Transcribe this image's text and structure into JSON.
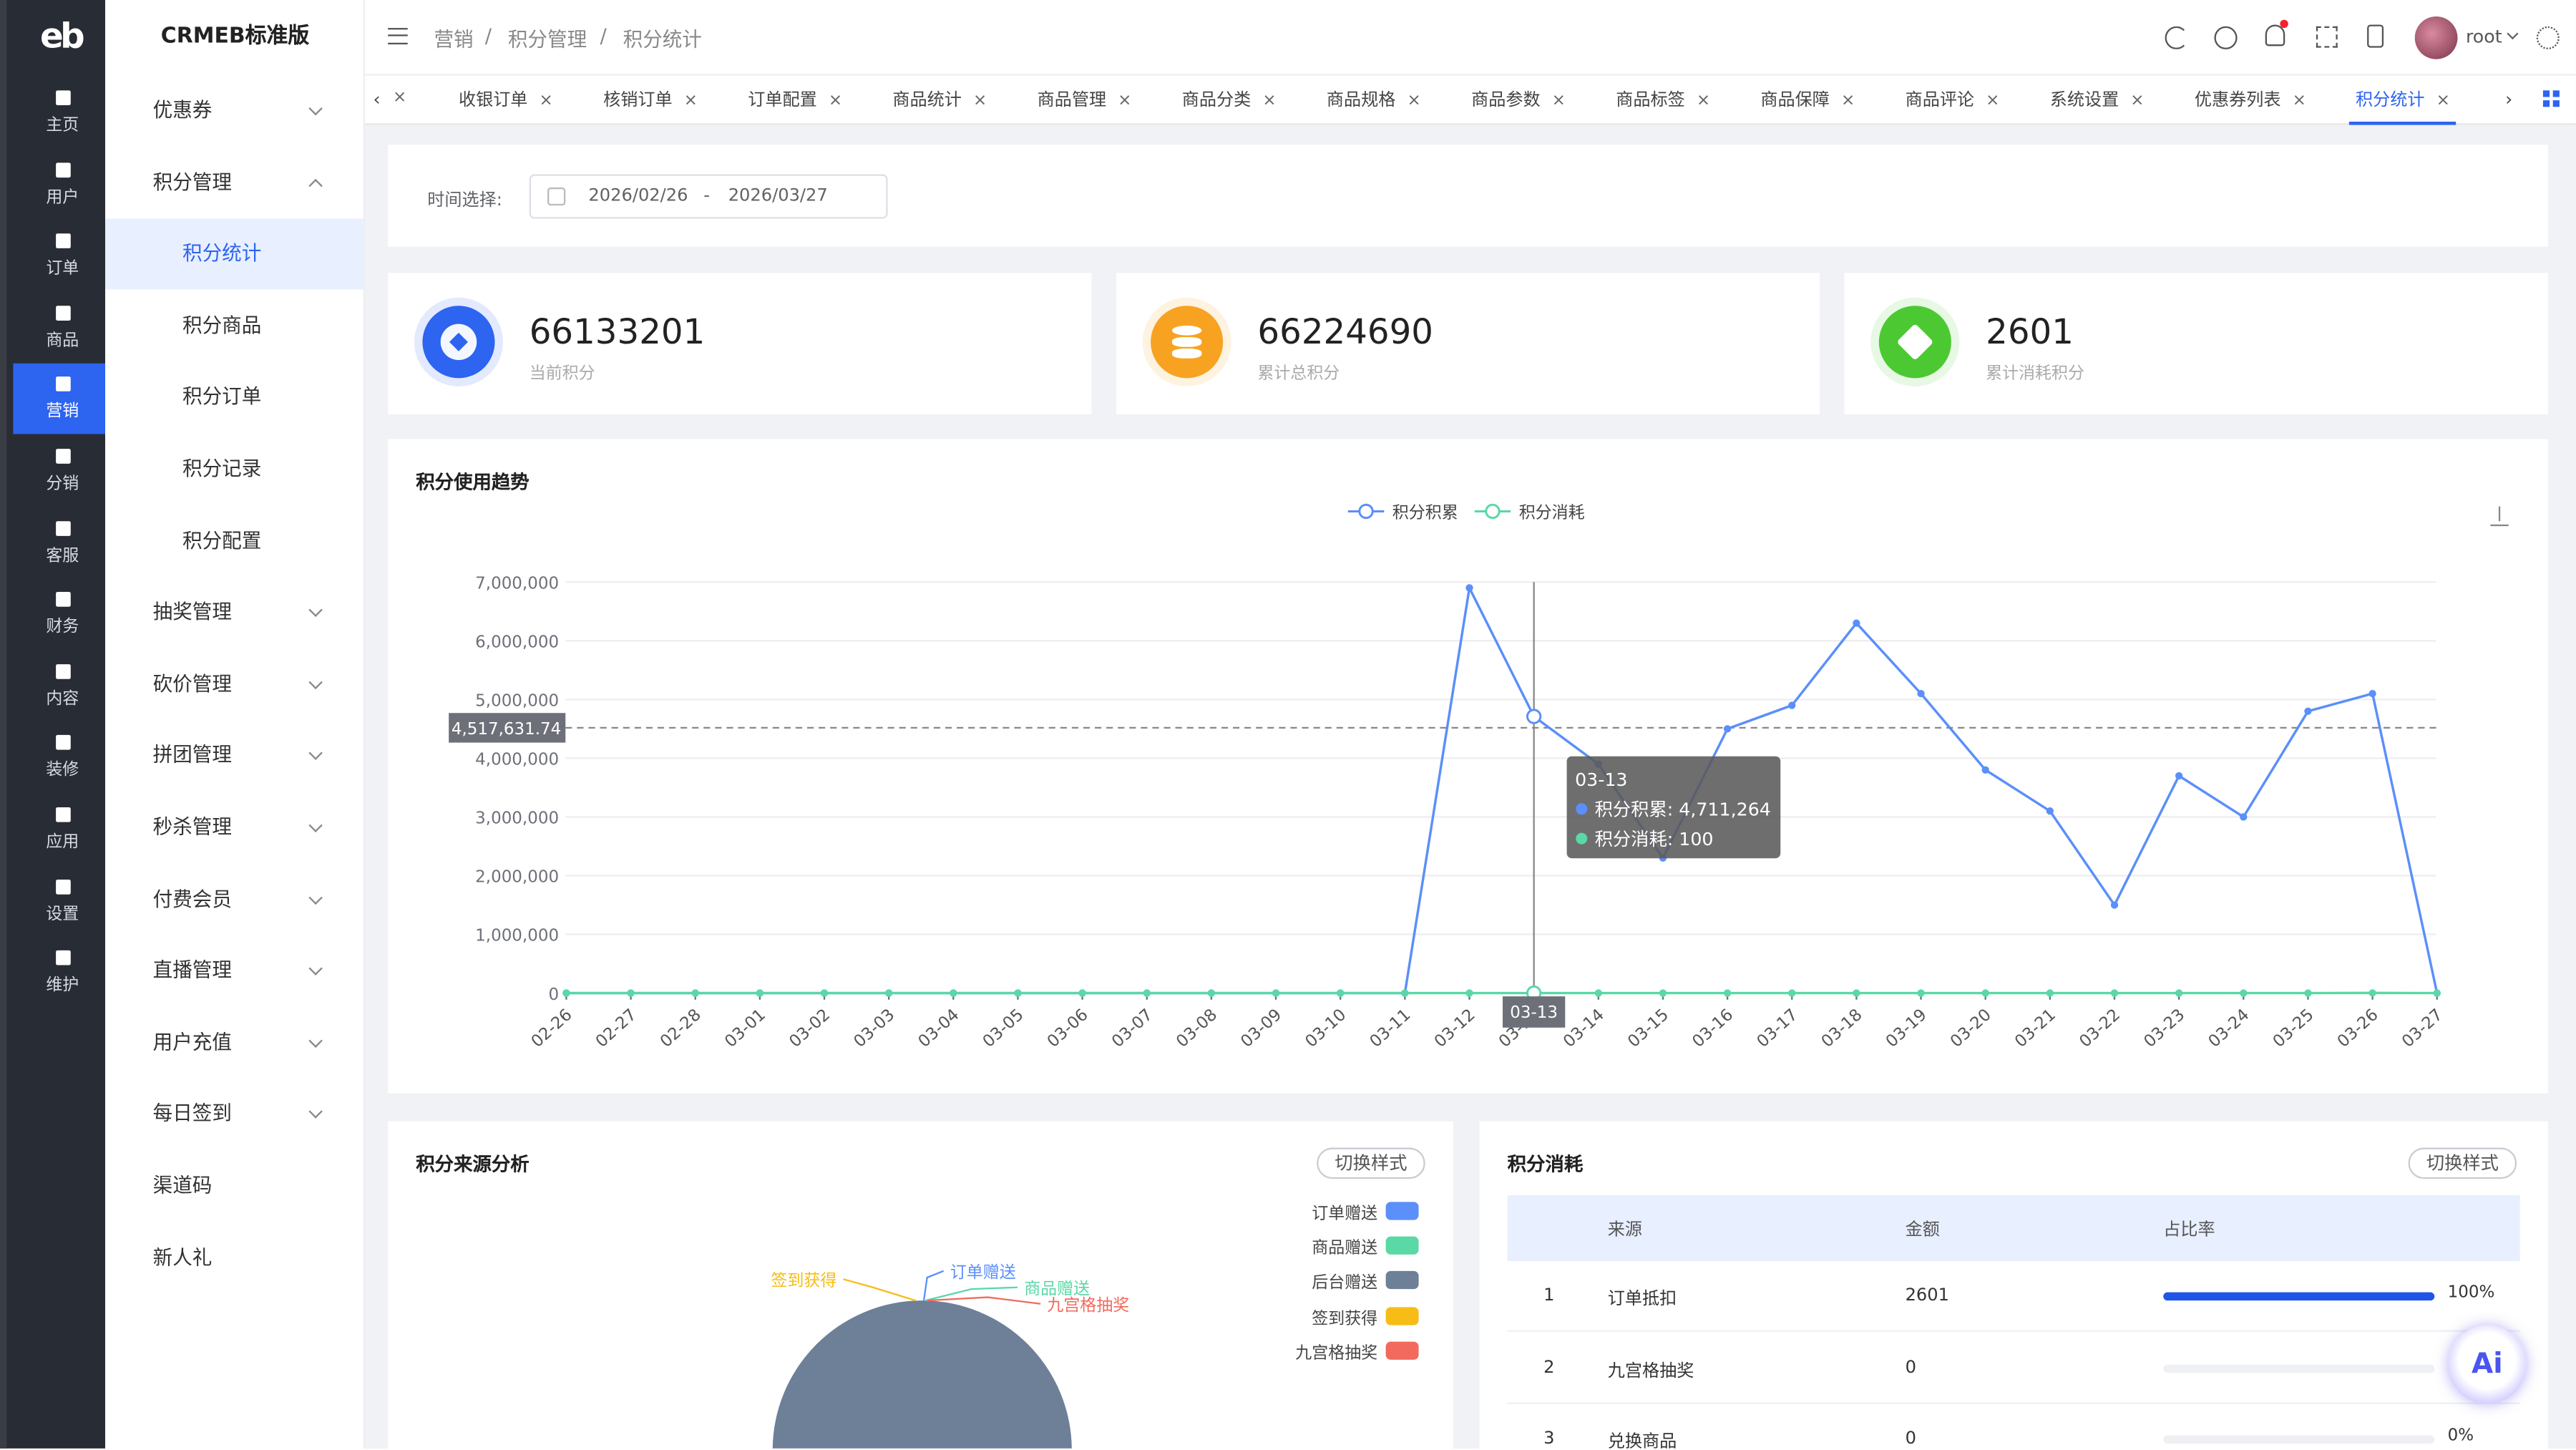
{
  "rail": {
    "logo": "eb",
    "items": [
      {
        "label": "主页",
        "icon": "home-icon"
      },
      {
        "label": "用户",
        "icon": "user-icon"
      },
      {
        "label": "订单",
        "icon": "order-icon"
      },
      {
        "label": "商品",
        "icon": "product-icon"
      },
      {
        "label": "营销",
        "icon": "marketing-icon",
        "active": true
      },
      {
        "label": "分销",
        "icon": "distribution-icon"
      },
      {
        "label": "客服",
        "icon": "service-icon"
      },
      {
        "label": "财务",
        "icon": "finance-icon"
      },
      {
        "label": "内容",
        "icon": "content-icon"
      },
      {
        "label": "装修",
        "icon": "decorate-icon"
      },
      {
        "label": "应用",
        "icon": "apps-icon"
      },
      {
        "label": "设置",
        "icon": "settings-icon"
      },
      {
        "label": "维护",
        "icon": "maintain-icon"
      }
    ]
  },
  "submenu": {
    "brand": "CRMEB标准版",
    "items": [
      {
        "label": "优惠券",
        "type": "group",
        "open": false
      },
      {
        "label": "积分管理",
        "type": "group",
        "open": true
      },
      {
        "label": "积分统计",
        "type": "sub",
        "active": true
      },
      {
        "label": "积分商品",
        "type": "sub"
      },
      {
        "label": "积分订单",
        "type": "sub"
      },
      {
        "label": "积分记录",
        "type": "sub"
      },
      {
        "label": "积分配置",
        "type": "sub"
      },
      {
        "label": "抽奖管理",
        "type": "group",
        "open": false
      },
      {
        "label": "砍价管理",
        "type": "group",
        "open": false
      },
      {
        "label": "拼团管理",
        "type": "group",
        "open": false
      },
      {
        "label": "秒杀管理",
        "type": "group",
        "open": false
      },
      {
        "label": "付费会员",
        "type": "group",
        "open": false
      },
      {
        "label": "直播管理",
        "type": "group",
        "open": false
      },
      {
        "label": "用户充值",
        "type": "group",
        "open": false
      },
      {
        "label": "每日签到",
        "type": "group",
        "open": false
      },
      {
        "label": "渠道码",
        "type": "plain"
      },
      {
        "label": "新人礼",
        "type": "plain"
      }
    ]
  },
  "header": {
    "breadcrumb": [
      "营销",
      "积分管理",
      "积分统计"
    ],
    "separator": "/",
    "username": "root",
    "notification_dot_color": "#f5222d"
  },
  "tabs": {
    "items": [
      "收银订单",
      "核销订单",
      "订单配置",
      "商品统计",
      "商品管理",
      "商品分类",
      "商品规格",
      "商品参数",
      "商品标签",
      "商品保障",
      "商品评论",
      "系统设置",
      "优惠券列表",
      "积分统计"
    ],
    "active": "积分统计",
    "close": "×"
  },
  "filter": {
    "label": "时间选择:",
    "start": "2026/02/26",
    "sep": "-",
    "end": "2026/03/27"
  },
  "stats": [
    {
      "value": "66133201",
      "label": "当前积分",
      "color": "#2d64f0"
    },
    {
      "value": "66224690",
      "label": "累计总积分",
      "color": "#f7a321"
    },
    {
      "value": "2601",
      "label": "累计消耗积分",
      "color": "#4cc932"
    }
  ],
  "trend": {
    "title": "积分使用趋势",
    "legend": [
      "积分积累",
      "积分消耗"
    ],
    "colors": {
      "accumulate": "#5b8ff9",
      "consume": "#5ad8a6"
    },
    "pointer_value": "4,517,631.74",
    "pointer_x_label": "03-13",
    "tooltip": {
      "date": "03-13",
      "line1": "积分积累: 4,711,264",
      "line2": "积分消耗: 100"
    }
  },
  "chart_data": {
    "type": "line",
    "x": [
      "02-26",
      "02-27",
      "02-28",
      "03-01",
      "03-02",
      "03-03",
      "03-04",
      "03-05",
      "03-06",
      "03-07",
      "03-08",
      "03-09",
      "03-10",
      "03-11",
      "03-12",
      "03-13",
      "03-14",
      "03-15",
      "03-16",
      "03-17",
      "03-18",
      "03-19",
      "03-20",
      "03-21",
      "03-22",
      "03-23",
      "03-24",
      "03-25",
      "03-26",
      "03-27"
    ],
    "yticks": [
      "0",
      "1,000,000",
      "2,000,000",
      "3,000,000",
      "4,000,000",
      "5,000,000",
      "6,000,000",
      "7,000,000"
    ],
    "ylim": [
      0,
      7000000
    ],
    "grid": true,
    "legend_position": "top",
    "series": [
      {
        "name": "积分积累",
        "values": [
          0,
          0,
          0,
          0,
          0,
          0,
          0,
          0,
          0,
          0,
          0,
          0,
          0,
          0,
          6900000,
          4711264,
          3900000,
          2300000,
          4500000,
          4900000,
          6300000,
          5100000,
          3800000,
          3100000,
          1500000,
          3700000,
          3000000,
          4800000,
          5100000,
          0
        ]
      },
      {
        "name": "积分消耗",
        "values": [
          0,
          0,
          0,
          0,
          0,
          0,
          0,
          0,
          0,
          0,
          0,
          0,
          0,
          0,
          0,
          100,
          0,
          0,
          0,
          0,
          0,
          0,
          0,
          0,
          0,
          0,
          0,
          0,
          2501,
          0
        ]
      }
    ]
  },
  "source": {
    "title": "积分来源分析",
    "switch": "切换样式",
    "legend": [
      {
        "label": "订单赠送",
        "color": "#5b8ff9"
      },
      {
        "label": "商品赠送",
        "color": "#5ad8a6"
      },
      {
        "label": "后台赠送",
        "color": "#6e7f98"
      },
      {
        "label": "签到获得",
        "color": "#f6bd16"
      },
      {
        "label": "九宫格抽奖",
        "color": "#f26a5d"
      }
    ],
    "pie_labels": [
      "签到获得",
      "订单赠送",
      "商品赠送",
      "九宫格抽奖"
    ]
  },
  "consume": {
    "title": "积分消耗",
    "switch": "切换样式",
    "headers": [
      "来源",
      "金额",
      "占比率"
    ],
    "rows": [
      {
        "idx": "1",
        "source": "订单抵扣",
        "amount": "2601",
        "pct": "100%",
        "ratio": 1
      },
      {
        "idx": "2",
        "source": "九宫格抽奖",
        "amount": "0",
        "pct": "",
        "ratio": 0
      },
      {
        "idx": "3",
        "source": "兑换商品",
        "amount": "0",
        "pct": "0%",
        "ratio": 0
      }
    ]
  },
  "ai_badge": "Ai"
}
